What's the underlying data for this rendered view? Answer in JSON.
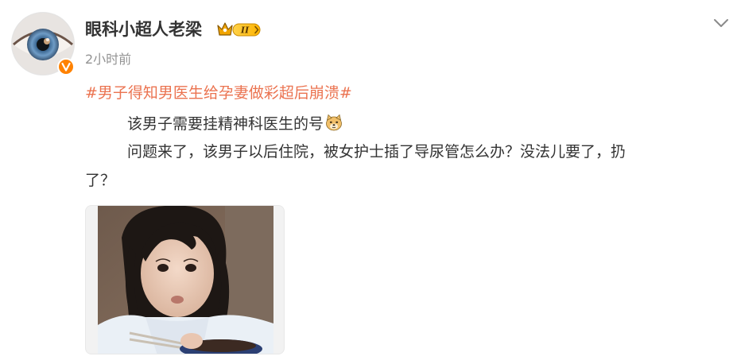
{
  "post": {
    "username": "眼科小超人老梁",
    "level_badge": "II",
    "timestamp": "2小时前",
    "topic": "#男子得知男医生给孕妻做彩超后崩溃#",
    "lines": [
      "该男子需要挂精神科医生的号",
      "问题来了，该男子以后住院，被女护士插了导尿管怎么办？没法儿要了，扔",
      "了？"
    ],
    "emoji": "doge-emoji",
    "image": "photo-girl-eating"
  },
  "colors": {
    "topic": "#eb7350",
    "verified": "#ff8200",
    "timestamp": "#939393",
    "text": "#333333"
  }
}
